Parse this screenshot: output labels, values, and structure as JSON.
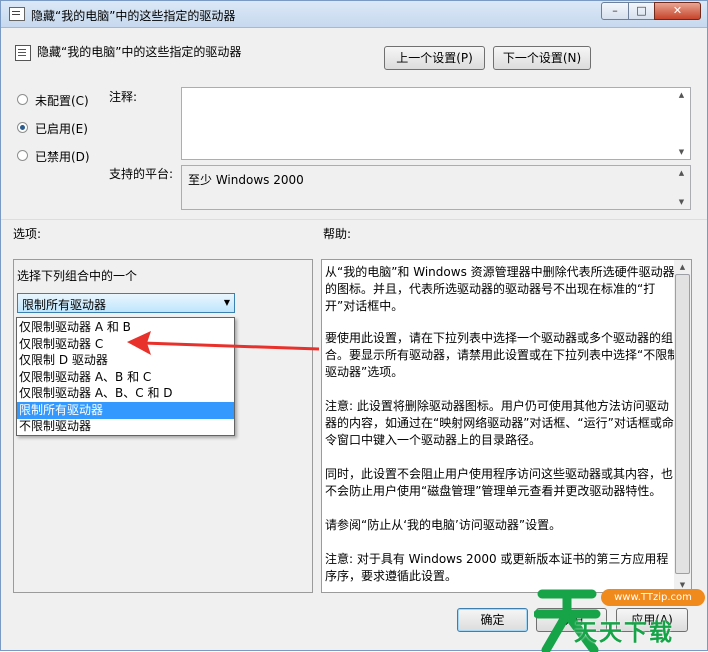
{
  "window": {
    "title": "隐藏“我的电脑”中的这些指定的驱动器",
    "controls": {
      "minimize": "–",
      "maximize": "□",
      "close": "✕"
    }
  },
  "header": {
    "policy_title": "隐藏“我的电脑”中的这些指定的驱动器",
    "prev_button": "上一个设置(P)",
    "next_button": "下一个设置(N)"
  },
  "state": {
    "options": [
      {
        "label": "未配置(C)",
        "checked": false
      },
      {
        "label": "已启用(E)",
        "checked": true
      },
      {
        "label": "已禁用(D)",
        "checked": false
      }
    ]
  },
  "comment": {
    "label": "注释:",
    "value": ""
  },
  "platform": {
    "label": "支持的平台:",
    "value": "至少 Windows 2000"
  },
  "options_section": {
    "label": "选项:",
    "caption": "选择下列组合中的一个",
    "selected": "限制所有驱动器",
    "items": [
      "仅限制驱动器 A 和 B",
      "仅限制驱动器 C",
      "仅限制 D 驱动器",
      "仅限制驱动器 A、B 和 C",
      "仅限制驱动器 A、B、C 和 D",
      "限制所有驱动器",
      "不限制驱动器"
    ],
    "selected_index": 5
  },
  "help_section": {
    "label": "帮助:",
    "paragraphs": [
      "从“我的电脑”和 Windows 资源管理器中删除代表所选硬件驱动器的图标。并且，代表所选驱动器的驱动器号不出现在标准的“打开”对话框中。",
      "要使用此设置，请在下拉列表中选择一个驱动器或多个驱动器的组合。要显示所有驱动器，请禁用此设置或在下拉列表中选择“不限制驱动器”选项。",
      "注意: 此设置将删除驱动器图标。用户仍可使用其他方法访问驱动器的内容，如通过在“映射网络驱动器”对话框、“运行”对话框或命令窗口中键入一个驱动器上的目录路径。",
      "同时，此设置不会阻止用户使用程序访问这些驱动器或其内容，也不会防止用户使用“磁盘管理”管理单元查看并更改驱动器特性。",
      "请参阅“防止从‘我的电脑’访问驱动器”设置。",
      "注意: 对于具有 Windows 2000 或更新版本证书的第三方应用程序序，要求遵循此设置。"
    ]
  },
  "footer": {
    "ok": "确定",
    "cancel": "取消",
    "apply": "应用(A)"
  },
  "watermark": {
    "text": "天天下载",
    "url": "www.TTzip.com"
  },
  "colors": {
    "selection": "#3399ff",
    "arrow": "#e8312a",
    "watermark_green": "#17a348",
    "watermark_orange": "#f08a1c"
  },
  "icons": {
    "policy": "policy-document-icon",
    "window": "window-app-icon",
    "annotation": "red-arrow-icon"
  }
}
